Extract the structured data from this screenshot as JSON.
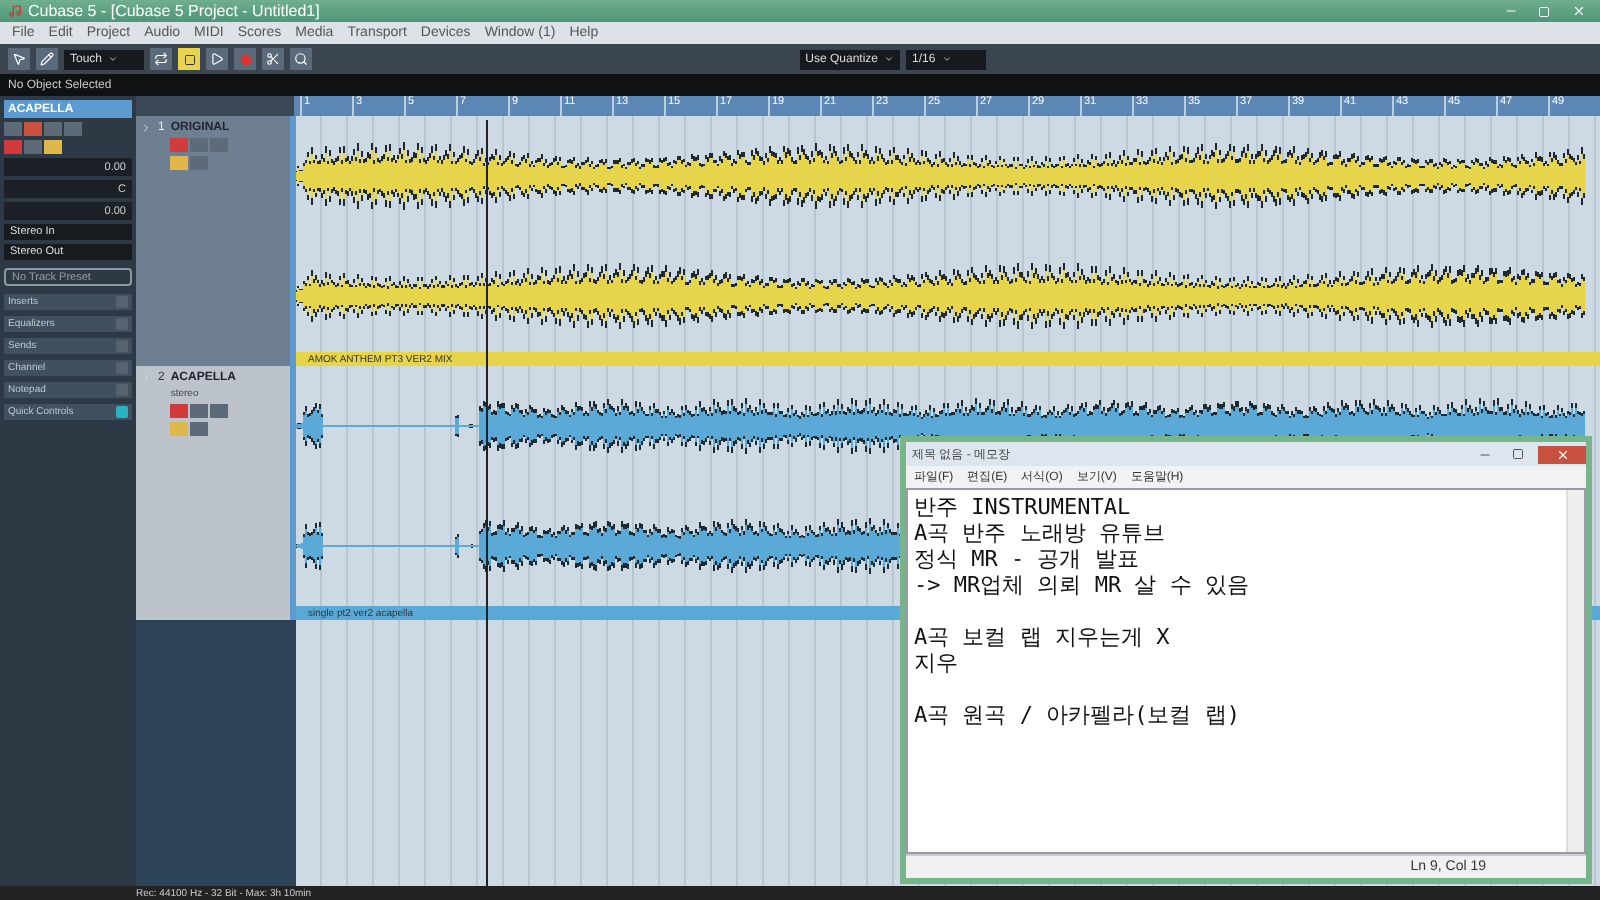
{
  "window": {
    "title": "Cubase 5 - [Cubase 5 Project - Untitled1]"
  },
  "menu": [
    "File",
    "Edit",
    "Project",
    "Audio",
    "MIDI",
    "Scores",
    "Media",
    "Transport",
    "Devices",
    "Window (1)",
    "Help"
  ],
  "toolbar": {
    "automation_mode": "Touch",
    "quantize_mode": "Use Quantize",
    "quantize_value": "1/16"
  },
  "info_line": "No Object Selected",
  "inspector": {
    "track_name": "ACAPELLA",
    "volume": "0.00",
    "pan": "C",
    "delay": "0.00",
    "input": "Stereo In",
    "output": "Stereo Out",
    "preset_placeholder": "No Track Preset",
    "sections": [
      {
        "label": "Inserts",
        "active": false
      },
      {
        "label": "Equalizers",
        "active": false
      },
      {
        "label": "Sends",
        "active": false
      },
      {
        "label": "Channel",
        "active": false
      },
      {
        "label": "Notepad",
        "active": false
      },
      {
        "label": "Quick Controls",
        "active": true
      }
    ]
  },
  "ruler": [
    "1",
    "3",
    "5",
    "7",
    "9",
    "11",
    "13",
    "15",
    "17",
    "19",
    "21",
    "23",
    "25",
    "27",
    "29",
    "31",
    "33",
    "35",
    "37",
    "39",
    "41",
    "43",
    "45",
    "47",
    "49"
  ],
  "tracks": [
    {
      "number": "1",
      "name": "ORIGINAL",
      "selected": false,
      "event": "AMOK ANTHEM PT3 VER2 MIX",
      "color": "#e6d44a"
    },
    {
      "number": "2",
      "name": "ACAPELLA",
      "channel": "stereo",
      "selected": true,
      "event": "single pt2 ver2 acapella",
      "color": "#5aa9d6"
    }
  ],
  "status_bar": "Rec: 44100 Hz - 32 Bit - Max: 3h 10min",
  "notepad": {
    "title": "제목 없음 - 메모장",
    "menu": [
      "파일(F)",
      "편집(E)",
      "서식(O)",
      "보기(V)",
      "도움말(H)"
    ],
    "paragraphs": [
      [
        "반주 INSTRUMENTAL",
        "A곡 반주 노래방 유튜브",
        "정식 MR - 공개 발표",
        "-> MR업체 의뢰 MR 살 수 있음"
      ],
      [
        "A곡 보컬 랩 지우는게 X",
        "지우"
      ],
      [
        "A곡 원곡 / 아카펠라(보컬 랩)"
      ]
    ],
    "status": "Ln 9, Col 19"
  }
}
